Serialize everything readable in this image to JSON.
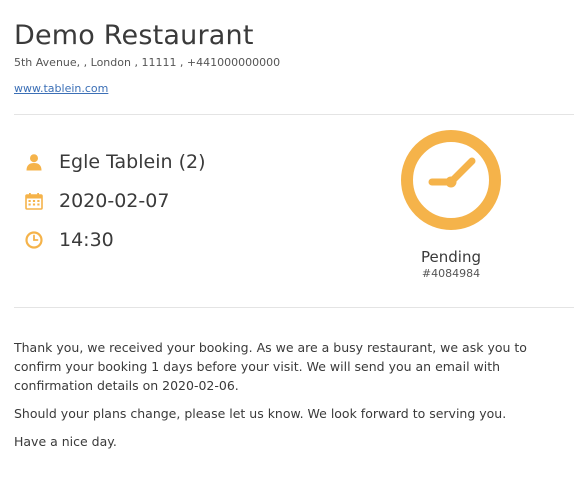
{
  "restaurant": {
    "name": "Demo Restaurant",
    "address": "5th Avenue, , London , 11111 , +441000000000",
    "website": "www.tablein.com"
  },
  "booking": {
    "guest": "Egle Tablein (2)",
    "date": "2020-02-07",
    "time": "14:30",
    "status": "Pending",
    "reference": "#4084984"
  },
  "message": {
    "paragraph1": "Thank you, we received your booking. As we are a busy restaurant, we ask you to confirm your booking 1 days before your visit. We will send you an email with confirmation details on 2020-02-06.",
    "paragraph2": "Should your plans change, please let us know. We look forward to serving you.",
    "paragraph3": "Have a nice day."
  },
  "icons": {
    "guest": "user-icon",
    "date": "calendar-icon",
    "time": "clock-icon",
    "status": "pending-clock-icon"
  },
  "colors": {
    "accent": "#f5b34a",
    "link": "#3b6fb6"
  }
}
